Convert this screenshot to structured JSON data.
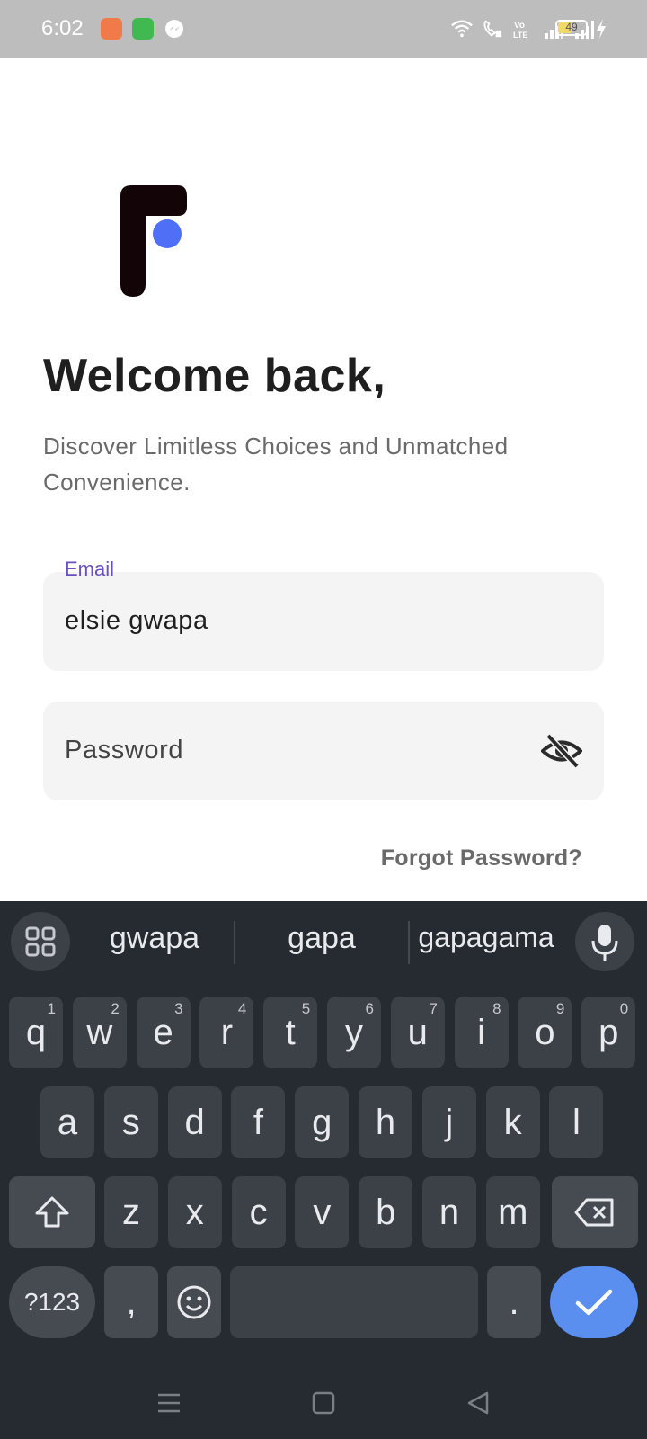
{
  "status_bar": {
    "time": "6:02",
    "battery_level": "49",
    "battery_fill_fraction": 0.49,
    "app_icons": [
      "game-app-icon",
      "market-app-icon",
      "messenger-icon"
    ],
    "system_icons": [
      "wifi-icon",
      "wifi-call-icon",
      "volte-icon",
      "signal-icon",
      "signal-icon",
      "battery-icon",
      "charging-icon"
    ]
  },
  "login": {
    "logo_icon": "brand-logo-icon",
    "title": "Welcome back,",
    "subtitle": "Discover Limitless Choices and Unmatched Convenience.",
    "email_label": "Email",
    "email_value": "elsie gwapa",
    "password_placeholder": "Password",
    "password_visibility_icon": "eye-off-icon",
    "forgot_password": "Forgot Password?"
  },
  "keyboard": {
    "suggestions": [
      "gwapa",
      "gapa",
      "gapagama"
    ],
    "row1": [
      {
        "k": "q",
        "h": "1"
      },
      {
        "k": "w",
        "h": "2"
      },
      {
        "k": "e",
        "h": "3"
      },
      {
        "k": "r",
        "h": "4"
      },
      {
        "k": "t",
        "h": "5"
      },
      {
        "k": "y",
        "h": "6"
      },
      {
        "k": "u",
        "h": "7"
      },
      {
        "k": "i",
        "h": "8"
      },
      {
        "k": "o",
        "h": "9"
      },
      {
        "k": "p",
        "h": "0"
      }
    ],
    "row2": [
      "a",
      "s",
      "d",
      "f",
      "g",
      "h",
      "j",
      "k",
      "l"
    ],
    "row3": [
      "z",
      "x",
      "c",
      "v",
      "b",
      "n",
      "m"
    ],
    "symbols_label": "?123",
    "comma": ",",
    "period": ".",
    "icons": {
      "apps": "grid-icon",
      "mic": "mic-icon",
      "shift": "shift-icon",
      "backspace": "backspace-icon",
      "emoji": "emoji-icon",
      "enter": "check-icon"
    }
  },
  "colors": {
    "accent_purple": "#6a4fc0",
    "logo_blue": "#4f6ff7",
    "keyboard_bg": "#262b31",
    "enter_blue": "#5a8ff0"
  }
}
